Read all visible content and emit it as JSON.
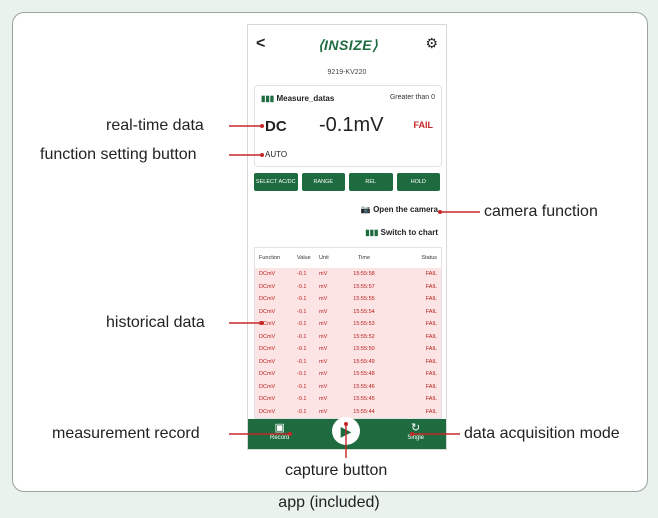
{
  "caption": "app (included)",
  "labels": {
    "realtime": "real-time data",
    "function_btn": "function setting button",
    "camera": "camera function",
    "history": "historical data",
    "record": "measurement record",
    "mode": "data acquisition mode",
    "capture": "capture button"
  },
  "app": {
    "back": "<",
    "logo": "⟨INSIZE⟩",
    "gear": "⚙",
    "model": "9219-KV220",
    "card": {
      "icon": "bar-chart-icon",
      "title": "Measure_datas",
      "condition": "Greater than 0",
      "mode": "DC",
      "value": "-0.1mV",
      "status": "FAIL",
      "range": "AUTO"
    },
    "buttons": [
      "SELECT AC/DC",
      "RANGE",
      "REL",
      "HOLD"
    ],
    "camera": "Open the camera",
    "to_chart": "Switch to chart",
    "table": {
      "headers": [
        "Function",
        "Value",
        "Unit",
        "Time",
        "Status"
      ],
      "rows": [
        [
          "DCmV",
          "-0.1",
          "mV",
          "15:55:58",
          "FAIL"
        ],
        [
          "DCmV",
          "-0.1",
          "mV",
          "15:55:57",
          "FAIL"
        ],
        [
          "DCmV",
          "-0.1",
          "mV",
          "15:55:55",
          "FAIL"
        ],
        [
          "DCmV",
          "-0.1",
          "mV",
          "15:55:54",
          "FAIL"
        ],
        [
          "DCmV",
          "-0.1",
          "mV",
          "15:55:53",
          "FAIL"
        ],
        [
          "DCmV",
          "-0.1",
          "mV",
          "15:55:52",
          "FAIL"
        ],
        [
          "DCmV",
          "-0.1",
          "mV",
          "15:55:50",
          "FAIL"
        ],
        [
          "DCmV",
          "-0.1",
          "mV",
          "15:55:49",
          "FAIL"
        ],
        [
          "DCmV",
          "-0.1",
          "mV",
          "15:55:48",
          "FAIL"
        ],
        [
          "DCmV",
          "-0.1",
          "mV",
          "15:55:46",
          "FAIL"
        ],
        [
          "DCmV",
          "-0.1",
          "mV",
          "15:55:45",
          "FAIL"
        ],
        [
          "DCmV",
          "-0.1",
          "mV",
          "15:55:44",
          "FAIL"
        ]
      ]
    },
    "bottom": {
      "record": "Record",
      "single": "Single"
    }
  },
  "colors": {
    "brand": "#1e6b3f",
    "fail": "#c62828",
    "row_bg": "#fde4e4"
  }
}
